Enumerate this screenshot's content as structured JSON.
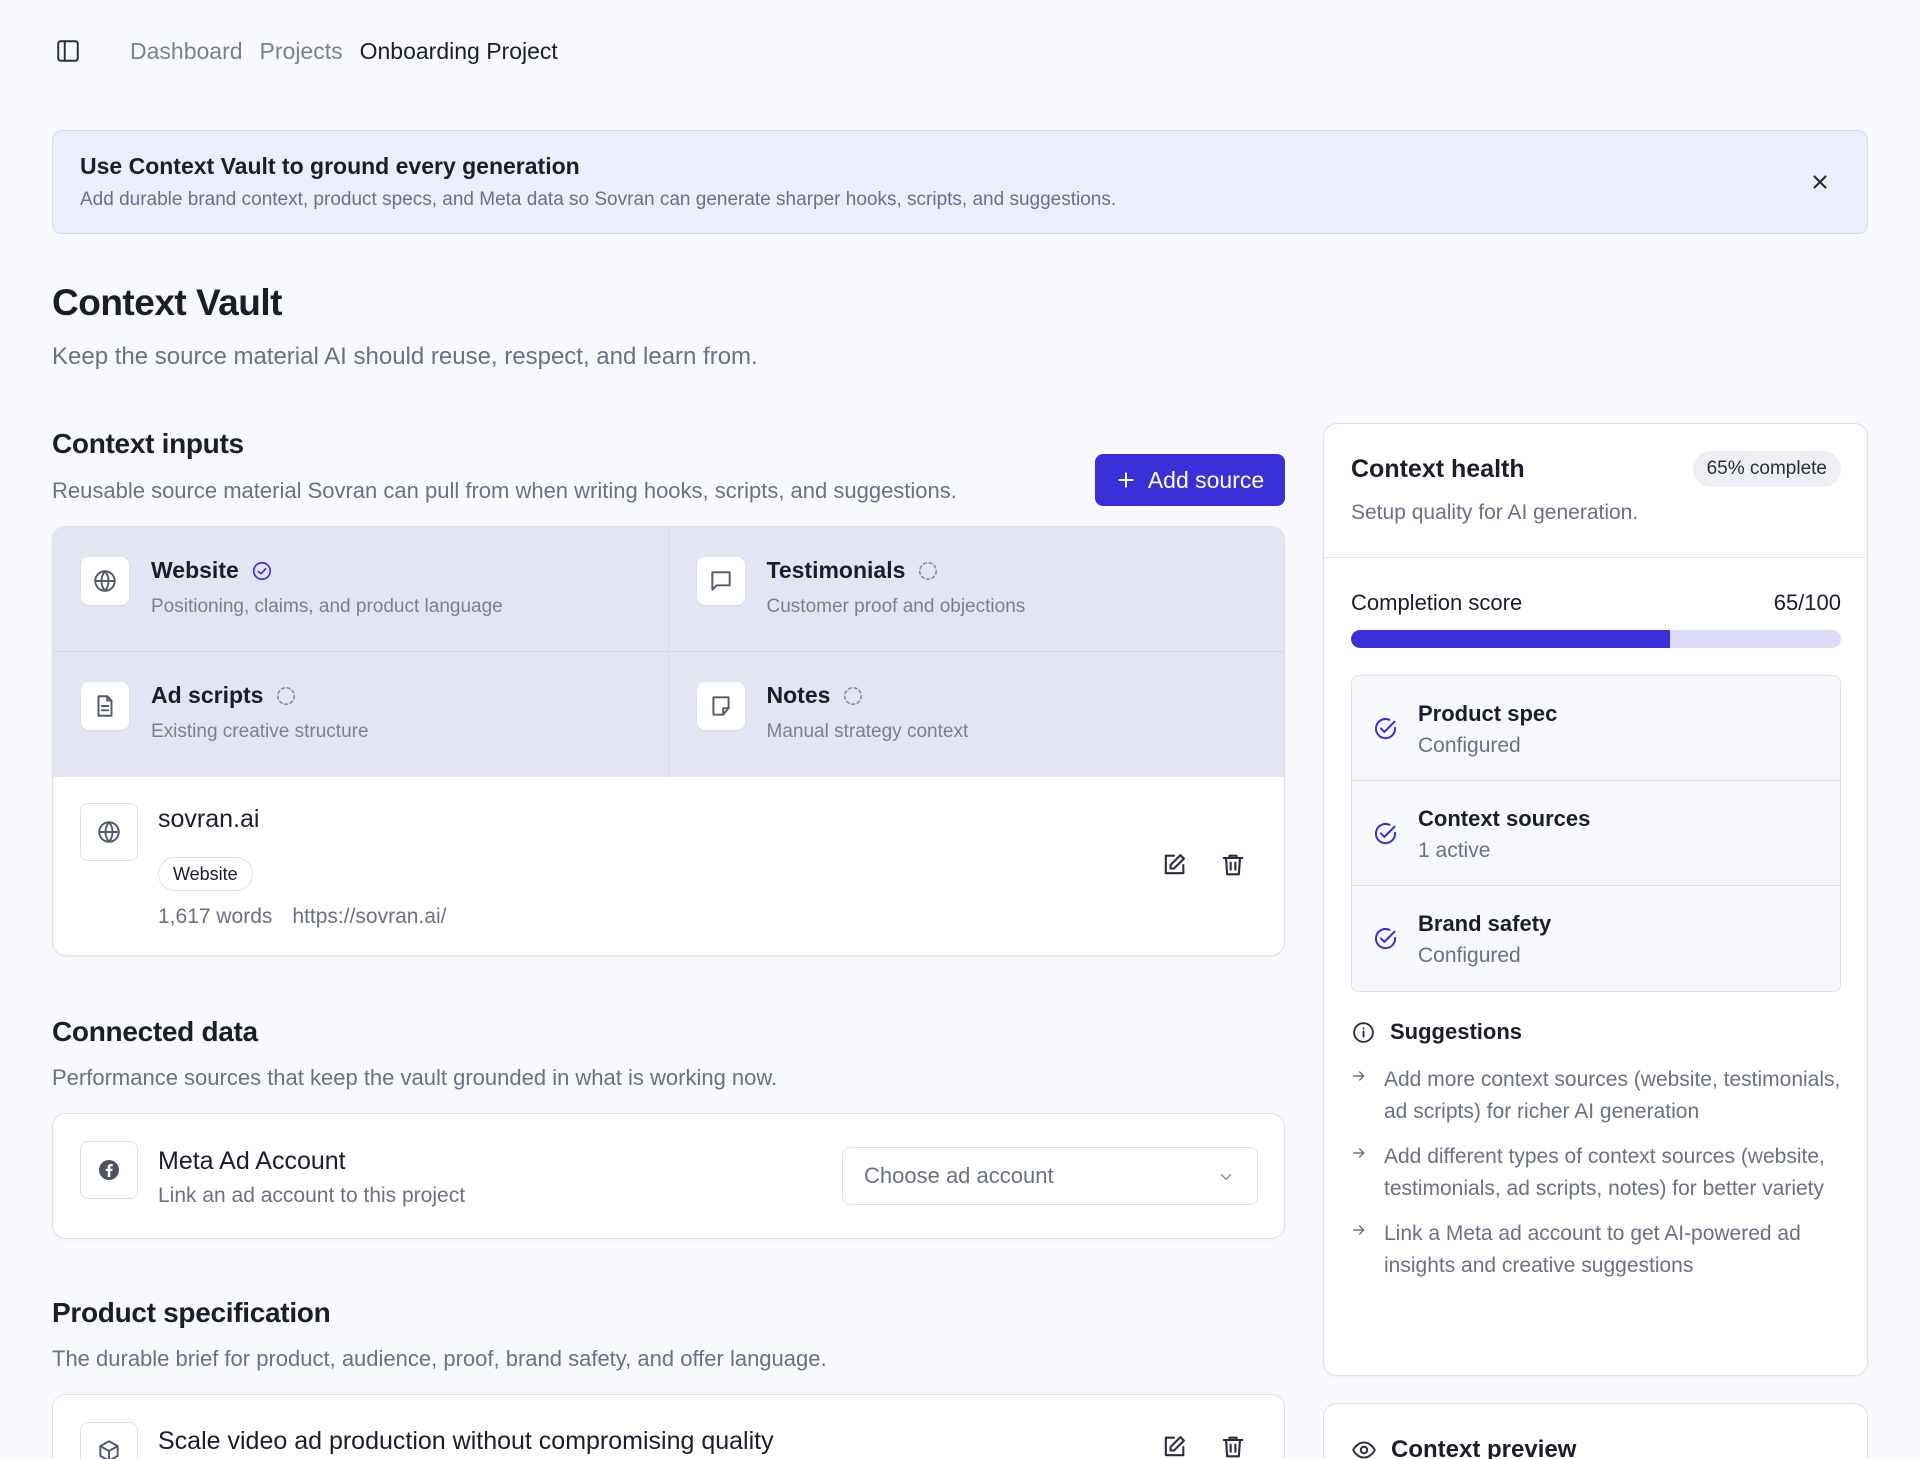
{
  "breadcrumb": [
    "Dashboard",
    "Projects",
    "Onboarding Project"
  ],
  "banner": {
    "title": "Use Context Vault to ground every generation",
    "text": "Add durable brand context, product specs, and Meta data so Sovran can generate sharper hooks, scripts, and suggestions."
  },
  "page": {
    "title": "Context Vault",
    "subtitle": "Keep the source material AI should reuse, respect, and learn from."
  },
  "context_inputs": {
    "title": "Context inputs",
    "subtitle": "Reusable source material Sovran can pull from when writing hooks, scripts, and suggestions.",
    "add_label": "Add source",
    "types": [
      {
        "name": "Website",
        "desc": "Positioning, claims, and product language",
        "icon": "globe-icon",
        "status": "complete"
      },
      {
        "name": "Testimonials",
        "desc": "Customer proof and objections",
        "icon": "message-square-icon",
        "status": "pending"
      },
      {
        "name": "Ad scripts",
        "desc": "Existing creative structure",
        "icon": "file-text-icon",
        "status": "pending"
      },
      {
        "name": "Notes",
        "desc": "Manual strategy context",
        "icon": "sticky-note-icon",
        "status": "pending"
      }
    ],
    "source": {
      "name": "sovran.ai",
      "badge": "Website",
      "words": "1,617 words",
      "url": "https://sovran.ai/"
    }
  },
  "connected_data": {
    "title": "Connected data",
    "subtitle": "Performance sources that keep the vault grounded in what is working now.",
    "meta": {
      "name": "Meta Ad Account",
      "desc": "Link an ad account to this project",
      "select_placeholder": "Choose ad account"
    }
  },
  "product_spec": {
    "title": "Product specification",
    "subtitle": "The durable brief for product, audience, proof, brand safety, and offer language.",
    "item_title": "Scale video ad production without compromising quality"
  },
  "health": {
    "title": "Context health",
    "badge": "65% complete",
    "subtitle": "Setup quality for AI generation.",
    "score_label": "Completion score",
    "score_text": "65/100",
    "score_fraction": 0.65,
    "checks": [
      {
        "name": "Product spec",
        "status": "Configured"
      },
      {
        "name": "Context sources",
        "status": "1 active"
      },
      {
        "name": "Brand safety",
        "status": "Configured"
      }
    ],
    "suggestions_title": "Suggestions",
    "suggestions": [
      "Add more context sources (website, testimonials, ad scripts) for richer AI generation",
      "Add different types of context sources (website, testimonials, ad scripts, notes) for better variety",
      "Link a Meta ad account to get AI-powered ad insights and creative suggestions"
    ]
  },
  "preview": {
    "title": "Context preview"
  },
  "colors": {
    "accent": "#3a30d9",
    "banner_bg": "#eceefd",
    "bar_track": "#dcdcf8"
  }
}
